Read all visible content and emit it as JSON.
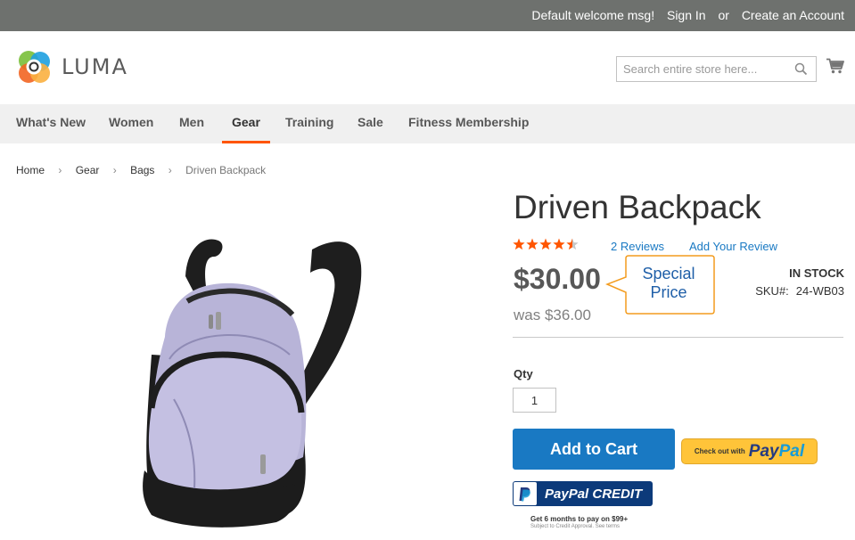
{
  "header_links": {
    "welcome": "Default welcome msg!",
    "sign_in": "Sign In",
    "or": "or",
    "create_account": "Create an Account"
  },
  "logo": {
    "text": "LUMA",
    "icon": "luma-logo-icon"
  },
  "search": {
    "placeholder": "Search entire store here...",
    "icon": "search-icon"
  },
  "cart": {
    "icon": "cart-icon"
  },
  "nav": {
    "items": [
      {
        "label": "What's New",
        "active": false
      },
      {
        "label": "Women",
        "active": false
      },
      {
        "label": "Men",
        "active": false
      },
      {
        "label": "Gear",
        "active": true
      },
      {
        "label": "Training",
        "active": false
      },
      {
        "label": "Sale",
        "active": false
      },
      {
        "label": "Fitness Membership",
        "active": false
      }
    ]
  },
  "breadcrumb": {
    "items": [
      "Home",
      "Gear",
      "Bags"
    ],
    "current": "Driven Backpack"
  },
  "product": {
    "title": "Driven Backpack",
    "rating": 4.5,
    "rating_max": 5,
    "reviews": "2 Reviews",
    "add_review": "Add Your Review",
    "price": "$30.00",
    "old_price": "was $36.00",
    "stock": "IN STOCK",
    "sku_label": "SKU#:",
    "sku_value": "24-WB03",
    "image": "backpack-image"
  },
  "callout": {
    "line1": "Special",
    "line2": "Price"
  },
  "form": {
    "qty_label": "Qty",
    "qty_value": "1",
    "add_to_cart": "Add to Cart"
  },
  "paypal": {
    "checkout_small": "Check out with",
    "pay": "Pay",
    "pal": "Pal",
    "credit_label": "PayPal CREDIT",
    "credit_note": "Get 6 months to pay on $99+",
    "credit_sub": "Subject to Credit Approval. See terms"
  },
  "colors": {
    "topbar": "#6e716e",
    "nav_bg": "#f0f0f0",
    "accent": "#ff5501",
    "primary": "#1979c3",
    "star": "#ff5501",
    "paypal_yellow": "#ffc439",
    "paypal_navy": "#0c3a7a",
    "callout_border": "#f39c1f",
    "callout_text": "#1f5fa8"
  }
}
